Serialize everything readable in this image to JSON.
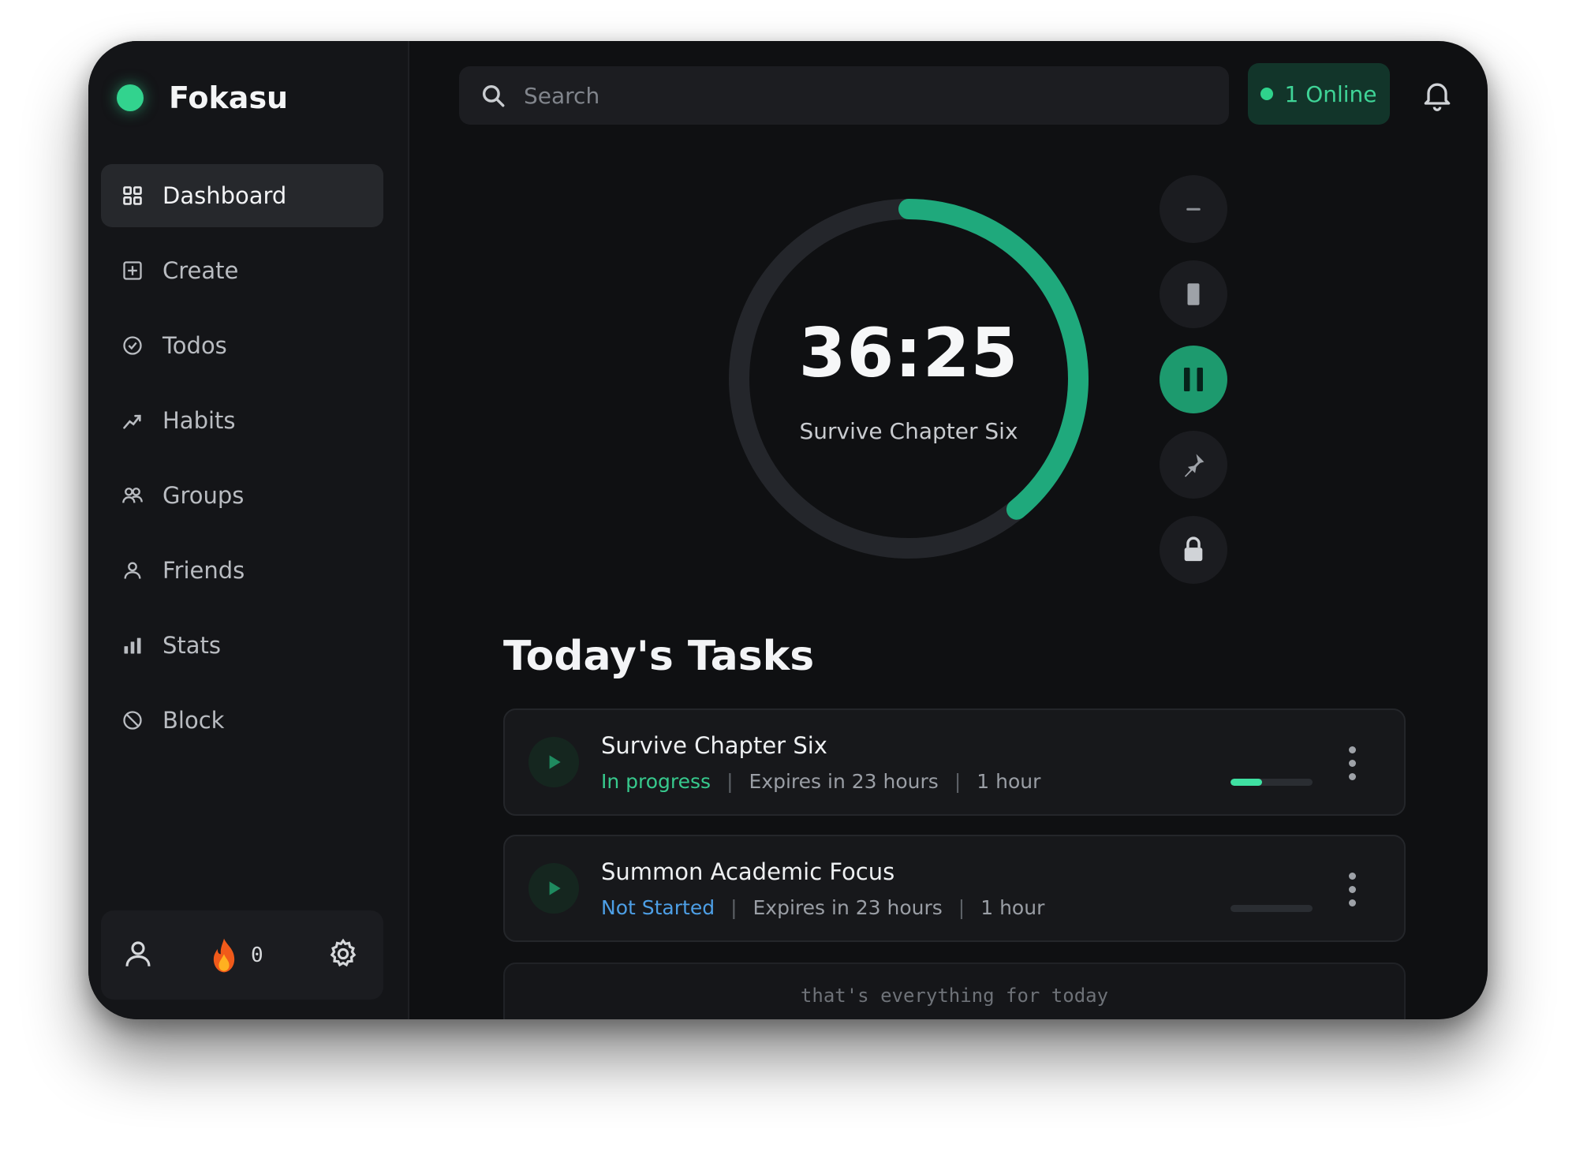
{
  "app": {
    "name": "Fokasu",
    "accent": "#32d38e"
  },
  "sidebar": {
    "items": [
      {
        "label": "Dashboard",
        "icon": "grid-icon",
        "active": true
      },
      {
        "label": "Create",
        "icon": "plus-square-icon"
      },
      {
        "label": "Todos",
        "icon": "check-circle-icon"
      },
      {
        "label": "Habits",
        "icon": "trend-icon"
      },
      {
        "label": "Groups",
        "icon": "users-icon"
      },
      {
        "label": "Friends",
        "icon": "user-icon"
      },
      {
        "label": "Stats",
        "icon": "bar-chart-icon"
      },
      {
        "label": "Block",
        "icon": "block-icon"
      }
    ],
    "footer": {
      "profile_icon": "user-icon",
      "streak_icon": "flame-icon",
      "streak_count": "0",
      "settings_icon": "gear-icon"
    }
  },
  "header": {
    "search_placeholder": "Search",
    "online_label": "1 Online",
    "bell_icon": "bell-icon"
  },
  "timer": {
    "time": "36:25",
    "task": "Survive Chapter Six",
    "progress": 0.39,
    "ring_color": "#1fa97c",
    "track_color": "#24262b"
  },
  "controls": [
    {
      "name": "minus-button",
      "icon": "minus-icon"
    },
    {
      "name": "stop-button",
      "icon": "stop-icon"
    },
    {
      "name": "pause-button",
      "icon": "pause-icon",
      "primary": true
    },
    {
      "name": "pin-button",
      "icon": "pin-icon"
    },
    {
      "name": "lock-button",
      "icon": "lock-icon"
    }
  ],
  "tasks": {
    "title": "Today's Tasks",
    "items": [
      {
        "name": "Survive Chapter Six",
        "status": "In progress",
        "expires": "Expires in 23 hours",
        "duration": "1 hour",
        "progress": 0.38
      },
      {
        "name": "Summon Academic Focus",
        "status": "Not Started",
        "expires": "Expires in 23 hours",
        "duration": "1 hour",
        "progress": 0
      }
    ],
    "footer_note": "that's everything for today"
  }
}
